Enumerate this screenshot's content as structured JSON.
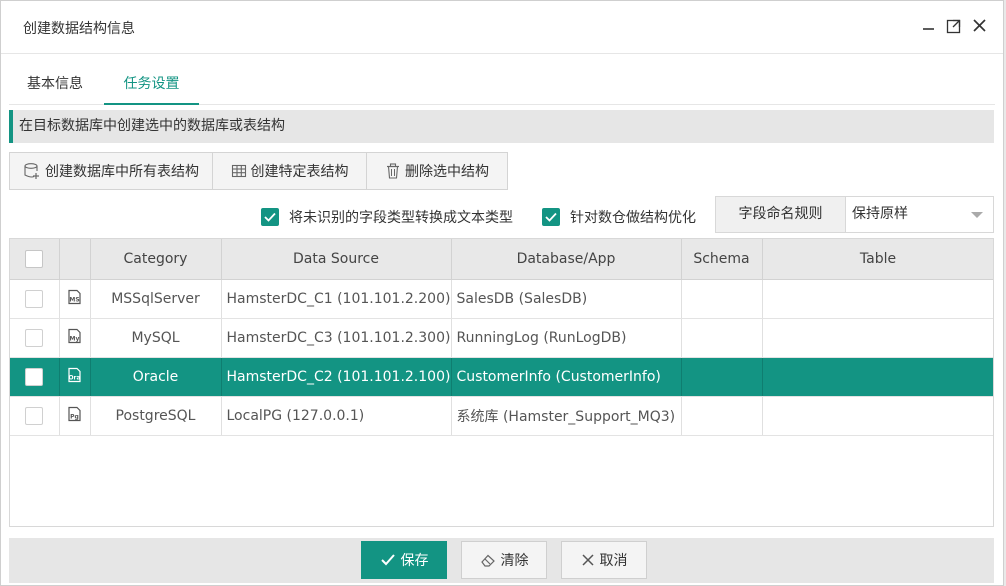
{
  "window": {
    "title": "创建数据结构信息"
  },
  "tabs": [
    {
      "label": "基本信息",
      "active": false
    },
    {
      "label": "任务设置",
      "active": true
    }
  ],
  "section": {
    "title": "在目标数据库中创建选中的数据库或表结构"
  },
  "toolbar": {
    "create_all_label": "创建数据库中所有表结构",
    "create_specific_label": "创建特定表结构",
    "delete_label": "删除选中结构"
  },
  "options": {
    "convert_unknown": {
      "label": "将未识别的字段类型转换成文本类型",
      "checked": true
    },
    "optimize_dw": {
      "label": "针对数仓做结构优化",
      "checked": true
    }
  },
  "naming": {
    "label": "字段命名规则",
    "value": "保持原样"
  },
  "table": {
    "columns": [
      "Category",
      "Data Source",
      "Database/App",
      "Schema",
      "Table"
    ],
    "rows": [
      {
        "icon": "mssql-icon",
        "badge": "MS",
        "category": "MSSqlServer",
        "source": "HamsterDC_C1 (101.101.2.200)",
        "db": "SalesDB (SalesDB)",
        "schema": "",
        "table": "",
        "selected": false
      },
      {
        "icon": "mysql-icon",
        "badge": "My",
        "category": "MySQL",
        "source": "HamsterDC_C3 (101.101.2.300)",
        "db": "RunningLog (RunLogDB)",
        "schema": "",
        "table": "",
        "selected": false
      },
      {
        "icon": "oracle-icon",
        "badge": "Ora",
        "category": "Oracle",
        "source": "HamsterDC_C2 (101.101.2.100)",
        "db": "CustomerInfo (CustomerInfo)",
        "schema": "",
        "table": "",
        "selected": true
      },
      {
        "icon": "postgresql-icon",
        "badge": "Pg",
        "category": "PostgreSQL",
        "source": "LocalPG (127.0.0.1)",
        "db": "系统库 (Hamster_Support_MQ3)",
        "schema": "",
        "table": "",
        "selected": false
      }
    ]
  },
  "footer": {
    "save_label": "保存",
    "clear_label": "清除",
    "cancel_label": "取消"
  },
  "colors": {
    "accent": "#139483"
  }
}
